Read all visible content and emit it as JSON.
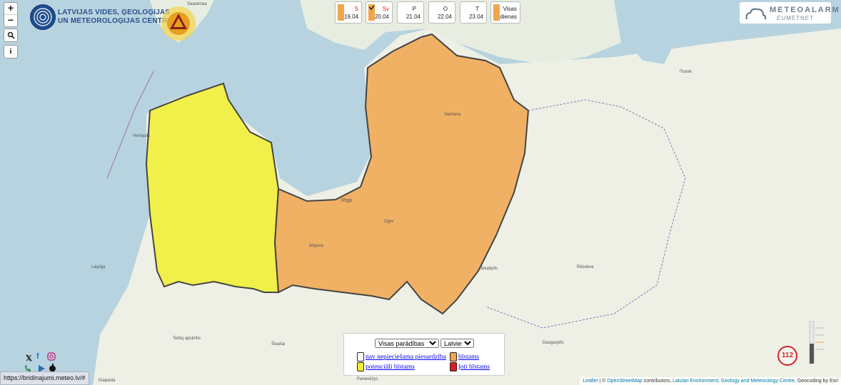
{
  "zoom": {
    "in_label": "+",
    "out_label": "−"
  },
  "search": {
    "icon": "search-icon"
  },
  "info": {
    "icon": "info-icon",
    "label": "i"
  },
  "header": {
    "org_line1": "LATVIJAS VIDES, ĢEOLOĢIJAS",
    "org_line2": "UN METEOROLOĢIJAS CENTRS"
  },
  "days": [
    {
      "abbr": "S",
      "date": "19.04",
      "color": "#f0a64c"
    },
    {
      "abbr": "Sv",
      "date": "20.04",
      "color": "#f0a64c"
    },
    {
      "abbr": "P",
      "date": "21.04",
      "color": ""
    },
    {
      "abbr": "O",
      "date": "22.04",
      "color": ""
    },
    {
      "abbr": "T",
      "date": "23.04",
      "color": ""
    },
    {
      "abbr": "Visas",
      "date": "dienas",
      "color": "#f0a64c"
    }
  ],
  "meteoalarm": {
    "title": "METEOALARM",
    "subtitle": "EUMETNET"
  },
  "legend": {
    "filter_selected": "Visas parādības",
    "language_selected": "Latviešu",
    "items": [
      {
        "label": "nav nepieciešama piesardzība",
        "color": "#ffffff"
      },
      {
        "label": "bīstams",
        "color": "#f0a64c"
      },
      {
        "label": "potenciāli bīstams",
        "color": "#f1f02e"
      },
      {
        "label": "ļoti bīstams",
        "color": "#e0181f"
      }
    ]
  },
  "status_url": "https://bridinajumi.meteo.lv/#",
  "attribution": {
    "leaflet": "Leaflet",
    "osm": "OpenStreetMap",
    "contributors": "contributors,",
    "lvgmc": "Latvian Environment, Geology and Meteorology Centre",
    "geocoding": "Geocoding by Esri"
  },
  "emergency": "112",
  "map_labels": {
    "saaremaa": "Saaremaa",
    "riga": "Rīga",
    "ventspils": "Ventspils",
    "liepaja": "Liepāja",
    "jelgava": "Jelgava",
    "ogre": "Ogre",
    "valmiera": "Valmiera",
    "pskov": "Псков",
    "jekabpils": "Jēkabpils",
    "rezekne": "Rēzekne",
    "daugavpils": "Daugavpils",
    "klaipeda": "Klaipėda",
    "siauliai": "Šiauliai",
    "panevezys": "Panevėžys",
    "telsiu": "Telšių apskritis"
  },
  "colors": {
    "sea": "#b7d3df",
    "land": "#eef0e6",
    "yellow_zone": "#f1f02e",
    "orange_zone": "#f0a64c"
  }
}
